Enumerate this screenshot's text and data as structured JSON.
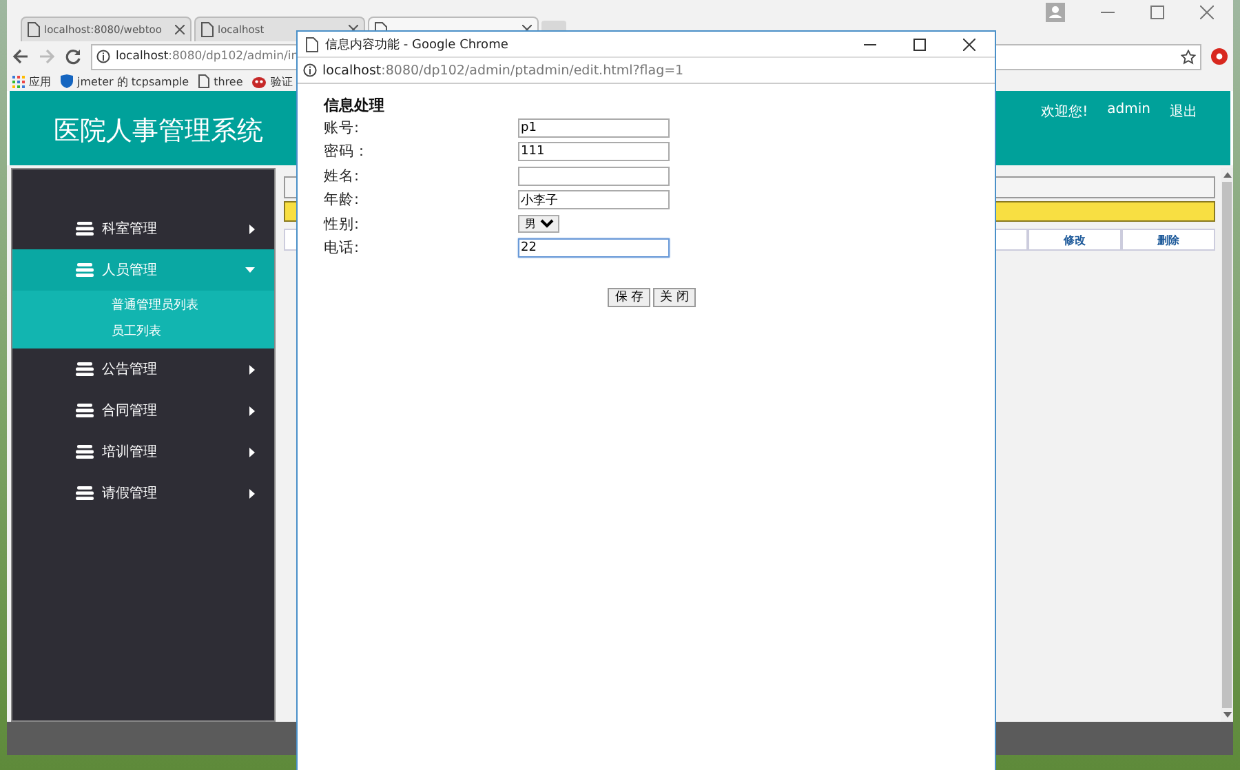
{
  "browser": {
    "tabs": [
      {
        "title": "localhost:8080/webtoo",
        "selected": false
      },
      {
        "title": "localhost",
        "selected": false
      },
      {
        "selected": true
      }
    ],
    "url": {
      "host": "localhost",
      "path": ":8080/dp102/admin/in"
    },
    "bookmarks": [
      {
        "label": "应用",
        "kind": "apps"
      },
      {
        "label": "jmeter 的 tcpsample",
        "kind": "shield"
      },
      {
        "label": "three",
        "kind": "page"
      },
      {
        "label": "验证",
        "kind": "bug"
      }
    ]
  },
  "page": {
    "title": "医院人事管理系统",
    "welcome": "欢迎您!",
    "user": "admin",
    "logout": "退出",
    "menu": [
      {
        "label": "科室管理",
        "expanded": false
      },
      {
        "label": "人员管理",
        "expanded": true,
        "children": [
          {
            "label": "普通管理员列表"
          },
          {
            "label": "员工列表"
          }
        ]
      },
      {
        "label": "公告管理",
        "expanded": false
      },
      {
        "label": "合同管理",
        "expanded": false
      },
      {
        "label": "培训管理",
        "expanded": false
      },
      {
        "label": "请假管理",
        "expanded": false
      }
    ],
    "table_actions": [
      "修改",
      "删除"
    ]
  },
  "popup": {
    "title": "信息内容功能 - Google Chrome",
    "url": {
      "host": "localhost",
      "path": ":8080/dp102/admin/ptadmin/edit.html?flag=1"
    },
    "heading": "信息处理",
    "fields": [
      {
        "label": "账号:",
        "kind": "text",
        "value": "p1",
        "focused": false
      },
      {
        "label": "密码：",
        "kind": "text",
        "value": "111",
        "focused": false
      },
      {
        "label": "姓名:",
        "kind": "text",
        "focused": false
      },
      {
        "label": "年龄:",
        "kind": "text",
        "value": "小李子",
        "focused": false
      },
      {
        "label": "性别:",
        "kind": "select",
        "value": "男",
        "focused": false
      },
      {
        "label": "电话:",
        "kind": "text",
        "value": "22",
        "focused": true
      }
    ],
    "buttons": [
      "保 存",
      "关 闭"
    ]
  }
}
